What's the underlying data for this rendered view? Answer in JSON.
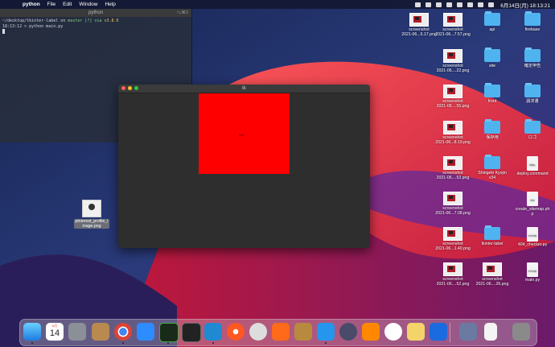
{
  "menubar": {
    "apple_icon": "apple-icon",
    "app_name": "python",
    "menus": [
      "File",
      "Edit",
      "Window",
      "Help"
    ],
    "datetime": "6月14日(月) 18:13:21"
  },
  "terminal": {
    "title": "python",
    "shortcut": "⌥⌘2",
    "line1_path": "~/desktop/tkinter-label on",
    "line1_branch": "master [?] via",
    "line1_version": "v3.8.6",
    "line2": "18:13:12 > python main.py"
  },
  "tk_window": {
    "title": "tk",
    "label_text": "test"
  },
  "desktop_icons": [
    {
      "type": "image",
      "label1": "screenshot",
      "label2": "2021-06...5.17.png"
    },
    {
      "type": "image",
      "label1": "screenshot",
      "label2": "2021-06...7.57.png"
    },
    {
      "type": "folder",
      "label1": "api",
      "label2": ""
    },
    {
      "type": "folder",
      "label1": "firebase",
      "label2": ""
    },
    {
      "type": "image",
      "label1": "screenshot",
      "label2": "2021-06....22.png"
    },
    {
      "type": "folder",
      "label1": "site",
      "label2": ""
    },
    {
      "type": "folder",
      "label1": "確定申告",
      "label2": ""
    },
    {
      "type": "image",
      "label1": "screenshot",
      "label2": "2021-06....55.png"
    },
    {
      "type": "folder",
      "label1": "front",
      "label2": ""
    },
    {
      "type": "folder",
      "label1": "請求書",
      "label2": ""
    },
    {
      "type": "image",
      "label1": "screenshot",
      "label2": "2021-06...8.19.png"
    },
    {
      "type": "folder",
      "label1": "保存用",
      "label2": ""
    },
    {
      "type": "folder",
      "label1": "ロゴ",
      "label2": ""
    },
    {
      "type": "image",
      "label1": "screenshot",
      "label2": "2021-06....53.png"
    },
    {
      "type": "folder",
      "label1": "Shingeki Kyojin",
      "label2": "v34"
    },
    {
      "type": "doc",
      "label1": "deploy.command",
      "label2": "",
      "badge": "SHELL"
    },
    {
      "type": "image",
      "label1": "screenshot",
      "label2": "2021-06...7.08.png"
    },
    {
      "type": "doc",
      "label1": "create_sitemap.ph",
      "label2": "p",
      "badge": "PHP"
    },
    {
      "type": "image",
      "label1": "screenshot",
      "label2": "2021-06...1.40.png"
    },
    {
      "type": "folder",
      "label1": "tkinter-label",
      "label2": ""
    },
    {
      "type": "doc",
      "label1": "404_checker.py",
      "label2": "",
      "badge": "PYTHON"
    },
    {
      "type": "image",
      "label1": "screenshot",
      "label2": "2021-06....52.png"
    },
    {
      "type": "image",
      "label1": "screenshot",
      "label2": "2021-06....26.png"
    },
    {
      "type": "doc",
      "label1": "main.py",
      "label2": "",
      "badge": "PYTHON"
    }
  ],
  "profile_icon": {
    "label1": "pinterest_profile_i",
    "label2": "mage.png"
  },
  "dock": {
    "calendar_month": "6月",
    "calendar_day": "14",
    "apps": [
      "finder",
      "calendar",
      "system-preferences",
      "script-editor",
      "chrome",
      "zoom",
      "terminal-green",
      "terminal",
      "vscode",
      "safari",
      "sequel",
      "sourcetree",
      "archive",
      "docker",
      "proxyman",
      "vlc",
      "telegram",
      "notes",
      "creative",
      "downloads",
      "document",
      "trash"
    ]
  }
}
